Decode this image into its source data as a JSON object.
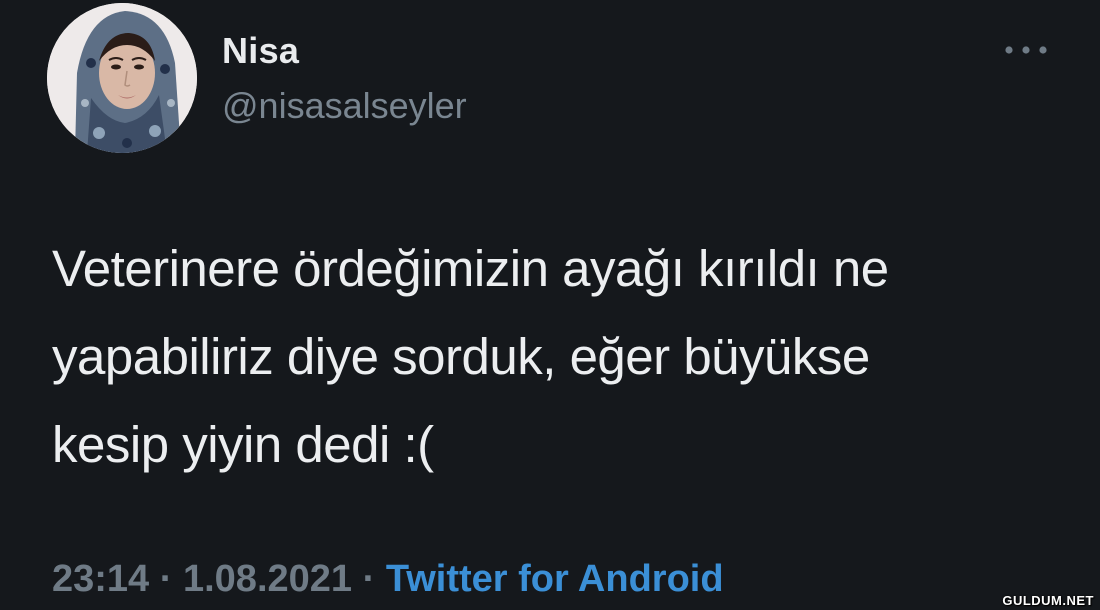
{
  "user": {
    "display_name": "Nisa",
    "handle": "@nisasalseyler",
    "avatar_icon": "profile-photo-avatar"
  },
  "more_icon": "ellipsis-icon",
  "tweet": {
    "text": "Veterinere ördeğimizin ayağı kırıldı ne\nyapabiliriz diye sorduk, eğer büyükse\nkesip yiyin dedi :(",
    "time": "23:14",
    "separator1": " · ",
    "date": "1.08.2021",
    "separator2": " · ",
    "source": "Twitter for Android"
  },
  "watermark": "GULDUM.NET",
  "colors": {
    "background": "#15181c",
    "text": "#eceef0",
    "muted": "#6f7b86",
    "accent": "#3b8fd6"
  }
}
